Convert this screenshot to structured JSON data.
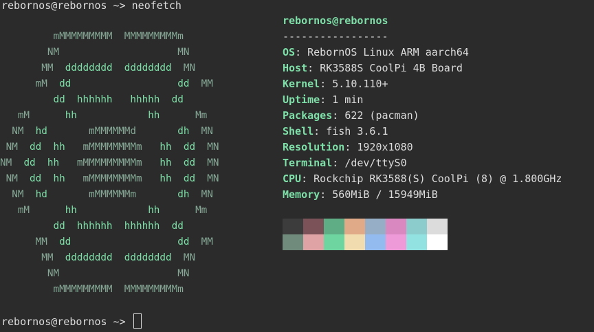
{
  "terminal": {
    "first_prompt": "rebornos@rebornos ~> neofetch",
    "last_prompt": "rebornos@rebornos ~> "
  },
  "logo": [
    [
      {
        "c": "m",
        "t": "         mMMMMMMMMM  MMMMMMMMMm"
      }
    ],
    [
      {
        "c": "m",
        "t": "        NM                    MN"
      }
    ],
    [
      {
        "c": "m",
        "t": "       MM  "
      },
      {
        "c": "d",
        "t": "dddddddd  dddddddd"
      },
      {
        "c": "m",
        "t": "  MN"
      }
    ],
    [
      {
        "c": "m",
        "t": "      mM  "
      },
      {
        "c": "d",
        "t": "dd                  dd"
      },
      {
        "c": "m",
        "t": "  MM"
      }
    ],
    [
      {
        "c": "d",
        "t": "         dd  hhhhhh   hhhhh  dd"
      }
    ],
    [
      {
        "c": "m",
        "t": "   mM      "
      },
      {
        "c": "d",
        "t": "hh            hh"
      },
      {
        "c": "m",
        "t": "      Mm"
      }
    ],
    [
      {
        "c": "m",
        "t": "  NM  "
      },
      {
        "c": "d",
        "t": "hd"
      },
      {
        "c": "m",
        "t": "       mMMMMMMd"
      },
      {
        "c": "d",
        "t": "       dh"
      },
      {
        "c": "m",
        "t": "  MN"
      }
    ],
    [
      {
        "c": "m",
        "t": " NM  "
      },
      {
        "c": "d",
        "t": "dd  hh"
      },
      {
        "c": "m",
        "t": "   mMMMMMMMMm"
      },
      {
        "c": "d",
        "t": "   hh  dd"
      },
      {
        "c": "m",
        "t": "  MN"
      }
    ],
    [
      {
        "c": "m",
        "t": "NM  "
      },
      {
        "c": "d",
        "t": "dd  hh"
      },
      {
        "c": "m",
        "t": "   mMMMMMMMMMm"
      },
      {
        "c": "d",
        "t": "   hh  dd"
      },
      {
        "c": "m",
        "t": "  MN"
      }
    ],
    [
      {
        "c": "m",
        "t": " NM  "
      },
      {
        "c": "d",
        "t": "dd  hh"
      },
      {
        "c": "m",
        "t": "   mMMMMMMMMm"
      },
      {
        "c": "d",
        "t": "   hh  dd"
      },
      {
        "c": "m",
        "t": "  MN"
      }
    ],
    [
      {
        "c": "m",
        "t": "  NM  "
      },
      {
        "c": "d",
        "t": "hd"
      },
      {
        "c": "m",
        "t": "       mMMMMMMm"
      },
      {
        "c": "d",
        "t": "       dh"
      },
      {
        "c": "m",
        "t": "  MN"
      }
    ],
    [
      {
        "c": "m",
        "t": "   mM      "
      },
      {
        "c": "d",
        "t": "hh            hh"
      },
      {
        "c": "m",
        "t": "      Mm"
      }
    ],
    [
      {
        "c": "d",
        "t": "         dd  hhhhhh  hhhhhh  dd"
      }
    ],
    [
      {
        "c": "m",
        "t": "      MM  "
      },
      {
        "c": "d",
        "t": "dd                  dd"
      },
      {
        "c": "m",
        "t": "  MM"
      }
    ],
    [
      {
        "c": "m",
        "t": "       MM  "
      },
      {
        "c": "d",
        "t": "dddddddd  dddddddd"
      },
      {
        "c": "m",
        "t": "  MN"
      }
    ],
    [
      {
        "c": "m",
        "t": "        NM                    MN"
      }
    ],
    [
      {
        "c": "m",
        "t": "         mMMMMMMMMM  MMMMMMMMMm"
      }
    ]
  ],
  "info": {
    "title": "rebornos@rebornos",
    "separator": "-----------------",
    "rows": [
      {
        "key": "OS",
        "value": "RebornOS Linux ARM aarch64"
      },
      {
        "key": "Host",
        "value": "RK3588S CoolPi 4B Board"
      },
      {
        "key": "Kernel",
        "value": "5.10.110+"
      },
      {
        "key": "Uptime",
        "value": "1 min"
      },
      {
        "key": "Packages",
        "value": "622 (pacman)"
      },
      {
        "key": "Shell",
        "value": "fish 3.6.1"
      },
      {
        "key": "Resolution",
        "value": "1920x1080"
      },
      {
        "key": "Terminal",
        "value": "/dev/ttyS0"
      },
      {
        "key": "CPU",
        "value": "Rockchip RK3588(S) CoolPi (8) @ 1.800GHz"
      },
      {
        "key": "Memory",
        "value": "560MiB / 15949MiB"
      }
    ]
  },
  "palette": {
    "row1": [
      "#3c3c3c",
      "#7a5257",
      "#5fad85",
      "#e0aa88",
      "#96aec6",
      "#da88c0",
      "#8ccccc",
      "#dcdcdc"
    ],
    "row2": [
      "#708a7c",
      "#e0a3a5",
      "#6fd5a0",
      "#f0dcae",
      "#94bbef",
      "#ee99d8",
      "#92e2e2",
      "#ffffff"
    ]
  }
}
